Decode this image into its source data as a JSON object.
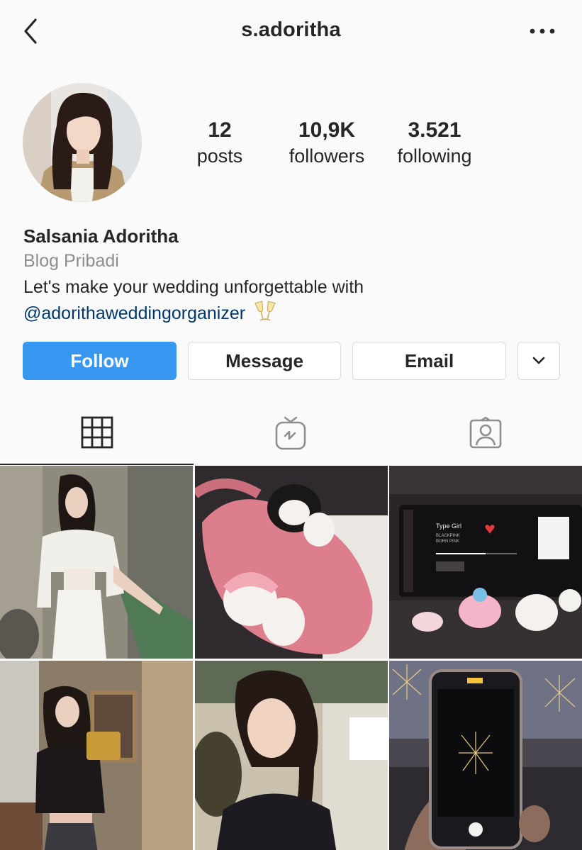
{
  "header": {
    "username": "s.adoritha",
    "back_icon": "chevron-left-icon",
    "more_icon": "more-horizontal-icon"
  },
  "profile": {
    "avatar_alt": "profile photo",
    "stats": {
      "posts": {
        "value": "12",
        "label": "posts"
      },
      "followers": {
        "value": "10,9K",
        "label": "followers"
      },
      "following": {
        "value": "3.521",
        "label": "following"
      }
    },
    "full_name": "Salsania Adoritha",
    "category": "Blog Pribadi",
    "bio_line1": "Let's make your wedding unforgettable with",
    "bio_mention": "@adorithaweddingorganizer",
    "bio_emoji": "🥂"
  },
  "actions": {
    "follow_label": "Follow",
    "message_label": "Message",
    "email_label": "Email",
    "more_icon": "chevron-down-icon"
  },
  "tabs": [
    {
      "name": "posts-grid",
      "icon": "grid-icon",
      "active": true
    },
    {
      "name": "igtv",
      "icon": "igtv-icon",
      "active": false
    },
    {
      "name": "tagged",
      "icon": "tagged-user-icon",
      "active": false
    }
  ],
  "posts": [
    {
      "description": "woman in white denim outfit"
    },
    {
      "description": "plush toys on pink bag"
    },
    {
      "description": "car dashboard with plush toys"
    },
    {
      "description": "mirror selfie in black top"
    },
    {
      "description": "woman with ponytail smiling"
    },
    {
      "description": "phone filming fireworks"
    }
  ],
  "car_screen": {
    "song_title": "Type Girl",
    "artist": "BLACKPINK",
    "album": "BORN PINK"
  },
  "colors": {
    "accent": "#3897f0",
    "link": "#00376b",
    "muted": "#8e8e8e",
    "text": "#262626",
    "background": "#fafafa",
    "border": "#dbdbdb"
  }
}
